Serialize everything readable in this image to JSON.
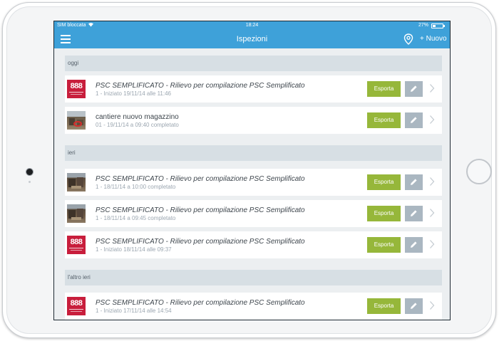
{
  "status_bar": {
    "carrier": "SIM bloccata",
    "time": "18:24",
    "battery": "27%",
    "battery_level": 0.27
  },
  "nav_bar": {
    "title": "Ispezioni",
    "new_label": "+ Nuovo",
    "menu_icon": "hamburger-icon",
    "location_icon": "location-pin-icon"
  },
  "colors": {
    "accent": "#3ea1d9",
    "export": "#96b73a",
    "edit": "#aab7c1",
    "section": "#d7dfe4",
    "logo": "#c81e3c"
  },
  "sections": [
    {
      "label": "oggi",
      "items": [
        {
          "title": "PSC SEMPLIFICATO - Rilievo per compilazione PSC Semplificato",
          "subtitle": "1 - Iniziato 19/11/14 alle 11:46",
          "export": "Esporta"
        },
        {
          "title": "cantiere nuovo magazzino",
          "subtitle": "01 - 19/11/14 a 09:40 completato",
          "export": "Esporta"
        }
      ]
    },
    {
      "label": "ieri",
      "items": [
        {
          "title": "PSC SEMPLIFICATO - Rilievo per compilazione PSC Semplificato",
          "subtitle": "1 - 18/11/14 a 10:00 completato",
          "export": "Esporta"
        },
        {
          "title": "PSC SEMPLIFICATO - Rilievo per compilazione PSC Semplificato",
          "subtitle": "1 - 18/11/14 a 09:45 completato",
          "export": "Esporta"
        },
        {
          "title": "PSC SEMPLIFICATO - Rilievo per compilazione PSC Semplificato",
          "subtitle": "1 - Iniziato 18/11/14 alle 09:37",
          "export": "Esporta"
        }
      ]
    },
    {
      "label": "l'altro ieri",
      "items": [
        {
          "title": "PSC SEMPLIFICATO - Rilievo per compilazione PSC Semplificato",
          "subtitle": "1 - Iniziato 17/11/14 alle 14:54",
          "export": "Esporta"
        }
      ]
    }
  ]
}
